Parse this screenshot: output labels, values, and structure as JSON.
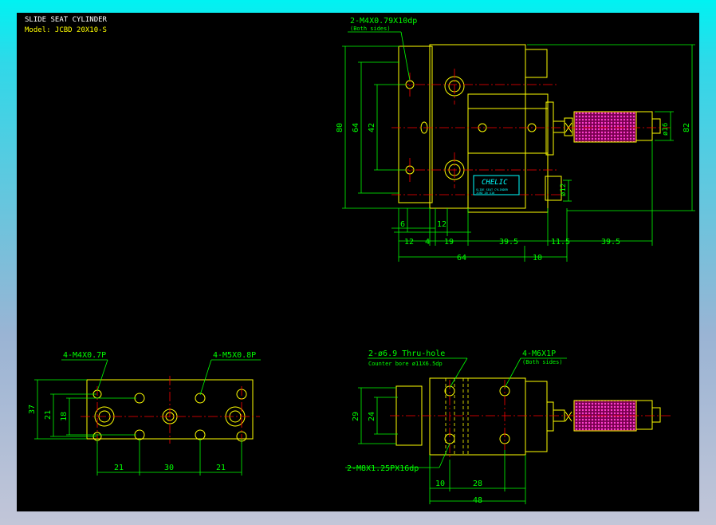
{
  "header": {
    "title": "SLIDE SEAT CYLINDER",
    "model": "Model:  JCBD  20X10-S"
  },
  "colors": {
    "frame_outer": "#00f2f2",
    "background": "#000000",
    "outline": "#ffff00",
    "dimension": "#00ff00",
    "centerline": "#ff0000",
    "brand": "#00ffff",
    "knurl": "#ff00ff"
  },
  "top_view": {
    "callouts": {
      "tapped_hole": "2-M4X0.79X10dp",
      "tapped_hole_note": "(Both sides)"
    },
    "dims": {
      "h80": "80",
      "h64": "64",
      "h42": "42",
      "h82": "82",
      "d16": "ø16",
      "d12": "ø12",
      "w6": "6",
      "w12a": "12",
      "w12b": "12",
      "w4": "4",
      "w19": "19",
      "w39a": "39.5",
      "w11": "11.5",
      "w39b": "39.5",
      "w64": "64",
      "w10": "10"
    },
    "brand_logo": "CHELIC",
    "brand_sub1": "SLIDE SEAT CYLINDER",
    "brand_sub2": "JCBD 20 X10"
  },
  "left_view": {
    "callouts": {
      "m4": "4-M4X0.7P",
      "m5": "4-M5X0.8P"
    },
    "dims": {
      "h37": "37",
      "h21": "21",
      "h18": "18",
      "w21a": "21",
      "w30": "30",
      "w21b": "21"
    }
  },
  "bottom_view": {
    "callouts": {
      "thru": "2-ø6.9  Thru-hole",
      "cbore": "Counter bore  ø11X6.5dp",
      "m6": "4-M6X1P",
      "m6_note": "(Both sides)",
      "m8": "2-M8X1.25PX16dp"
    },
    "dims": {
      "h29": "29",
      "h24": "24",
      "w10": "10",
      "w28": "28",
      "w48": "48"
    }
  }
}
